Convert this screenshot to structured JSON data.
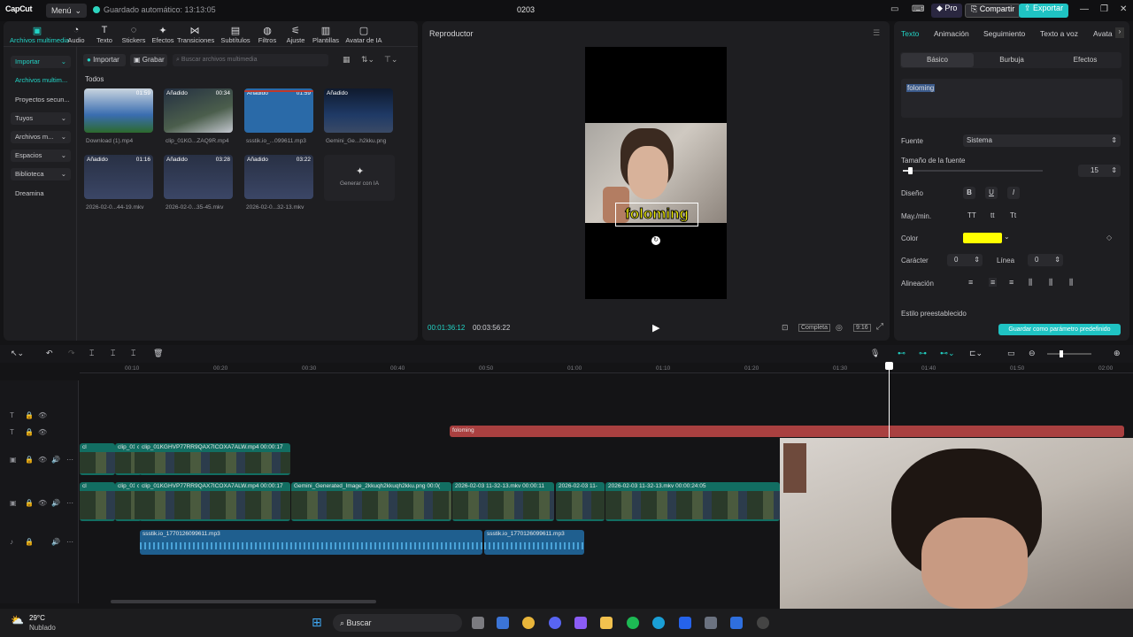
{
  "app": {
    "logo": "CapCut",
    "menu_label": "Menú",
    "autosave": "Guardado automático: 13:13:05",
    "project_title": "0203",
    "pro_label": "Pro",
    "share_label": "Compartir",
    "export_label": "Exportar"
  },
  "toolbar": [
    {
      "label": "Archivos multimedia",
      "icon": "media-icon"
    },
    {
      "label": "Audio",
      "icon": "audio-icon"
    },
    {
      "label": "Texto",
      "icon": "text-icon"
    },
    {
      "label": "Stickers",
      "icon": "sticker-icon"
    },
    {
      "label": "Efectos",
      "icon": "effects-icon"
    },
    {
      "label": "Transiciones",
      "icon": "transition-icon"
    },
    {
      "label": "Subtítulos",
      "icon": "subtitle-icon"
    },
    {
      "label": "Filtros",
      "icon": "filter-icon"
    },
    {
      "label": "Ajuste",
      "icon": "adjust-icon"
    },
    {
      "label": "Plantillas",
      "icon": "template-icon"
    },
    {
      "label": "Avatar de IA",
      "icon": "avatar-icon"
    }
  ],
  "sidebar": {
    "items": [
      {
        "label": "Importar"
      },
      {
        "label": "Archivos multim..."
      },
      {
        "label": "Proyectos secun..."
      },
      {
        "label": "Tuyos"
      },
      {
        "label": "Archivos m..."
      },
      {
        "label": "Espacios"
      },
      {
        "label": "Biblioteca"
      },
      {
        "label": "Dreamina"
      }
    ]
  },
  "media": {
    "import_button": "Importar",
    "record_button": "Grabar",
    "search_placeholder": "Buscar archivos multimedia",
    "section_title": "Todos",
    "generate_label": "Generar con IA",
    "items": [
      {
        "name": "Download (1).mp4",
        "duration": "01:59",
        "tag": ""
      },
      {
        "name": "clip_01KG...ZAQ9R.mp4",
        "duration": "00:34",
        "tag": "Añadido"
      },
      {
        "name": "ssstik.io_...099611.mp3",
        "duration": "01:59",
        "tag": "Añadido"
      },
      {
        "name": "Gemini_Ge...h2kku.png",
        "duration": "",
        "tag": "Añadido"
      },
      {
        "name": "2026-02-0...44-19.mkv",
        "duration": "01:16",
        "tag": "Añadido"
      },
      {
        "name": "2026-02-0...35-45.mkv",
        "duration": "03:28",
        "tag": "Añadido"
      },
      {
        "name": "2026-02-0...32-13.mkv",
        "duration": "03:22",
        "tag": "Añadido"
      }
    ]
  },
  "player": {
    "title": "Reproductor",
    "overlay_text": "foloming",
    "current_time": "00:01:36:12",
    "total_time": "00:03:56:22",
    "full_label": "Completa",
    "ratio_label": "9:16"
  },
  "properties": {
    "tabs": [
      "Texto",
      "Animación",
      "Seguimiento",
      "Texto a voz",
      "Avata"
    ],
    "subtabs": [
      "Básico",
      "Burbuja",
      "Efectos"
    ],
    "text_value": "foloming",
    "font_label": "Fuente",
    "font_value": "Sistema",
    "size_label": "Tamaño de la fuente",
    "size_value": "15",
    "size_level": 0.05,
    "design_label": "Diseño",
    "case_label": "May./min.",
    "case_options": [
      "TT",
      "tt",
      "Tt"
    ],
    "color_label": "Color",
    "color_value": "#ffff00",
    "char_label": "Carácter",
    "char_value": "0",
    "line_label": "Línea",
    "line_value": "0",
    "align_label": "Alineación",
    "preset_label": "Estilo preestablecido",
    "save_preset_button": "Guardar como parámetro predefinido"
  },
  "timeline": {
    "ruler": [
      "00:10",
      "00:20",
      "00:30",
      "00:40",
      "00:50",
      "01:00",
      "01:10",
      "01:20",
      "01:30",
      "01:40",
      "01:50",
      "02:00"
    ],
    "text_clip": "foloming",
    "overlay_clips": [
      {
        "label": "cl"
      },
      {
        "label": "clip_01KG"
      },
      {
        "label": "clip_("
      },
      {
        "label": "clip_01KGHVP77RR9QAX7ICOXA7ALW.mp4   00:00:17"
      }
    ],
    "main_clips": [
      {
        "label": "cl"
      },
      {
        "label": "clip_01KG"
      },
      {
        "label": "clip_("
      },
      {
        "label": "clip_01KGHVP77RR9QAX7ICOXA7ALW.mp4   00:00:17"
      },
      {
        "label": "Gemini_Generated_Image_2kkuqh2kkuqh2kku.png   00:0("
      },
      {
        "label": "2026-02-03 11-32-13.mkv   00:00:11"
      },
      {
        "label": "2026-02-03 11-"
      },
      {
        "label": "2026-02-03 11-32-13.mkv   00:00:24:05"
      }
    ],
    "audio_clips": [
      {
        "label": "ssstik.io_1770126099611.mp3"
      },
      {
        "label": "ssstik.io_1770126099611.mp3"
      }
    ]
  },
  "taskbar": {
    "weather_temp": "29°C",
    "weather_desc": "Nublado",
    "search_label": "Buscar"
  }
}
